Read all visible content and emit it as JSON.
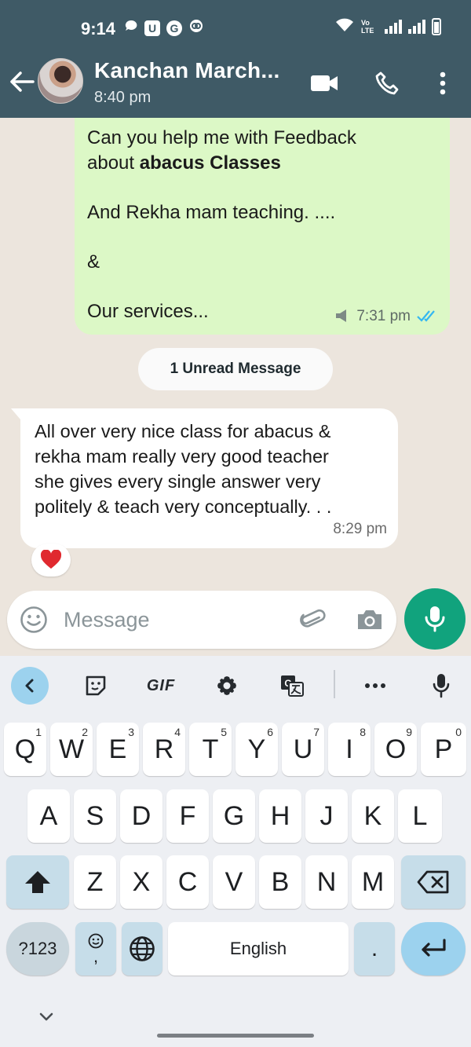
{
  "status_bar": {
    "time": "9:14",
    "left_icons": [
      "chat-bubble-icon",
      "u-badge-icon",
      "g-badge-icon",
      "cloud-icon"
    ],
    "network_label": "Vo LTE"
  },
  "header": {
    "contact_name": "Kanchan March...",
    "subtitle": "8:40 pm"
  },
  "messages": {
    "outgoing": {
      "line1": "Can you help me with  Feedback",
      "line2_prefix": "about ",
      "line2_bold": "abacus Classes",
      "line3": "",
      "line4": "And Rekha mam teaching. ....",
      "line5": "",
      "line6": "&",
      "line7": "",
      "line8": "Our services...",
      "time": "7:31 pm",
      "status": "read"
    },
    "unread_label": "1 Unread Message",
    "incoming": {
      "lines": [
        "All over very nice class for abacus &",
        "rekha mam really very good  teacher",
        "she gives every single answer very",
        "politely & teach very conceptually. .  ."
      ],
      "time": "8:29 pm",
      "reaction": "heart"
    }
  },
  "composer": {
    "placeholder": "Message"
  },
  "keyboard": {
    "toolbar": {
      "gif_label": "GIF"
    },
    "row1": [
      {
        "k": "Q",
        "n": "1"
      },
      {
        "k": "W",
        "n": "2"
      },
      {
        "k": "E",
        "n": "3"
      },
      {
        "k": "R",
        "n": "4"
      },
      {
        "k": "T",
        "n": "5"
      },
      {
        "k": "Y",
        "n": "6"
      },
      {
        "k": "U",
        "n": "7"
      },
      {
        "k": "I",
        "n": "8"
      },
      {
        "k": "O",
        "n": "9"
      },
      {
        "k": "P",
        "n": "0"
      }
    ],
    "row2": [
      "A",
      "S",
      "D",
      "F",
      "G",
      "H",
      "J",
      "K",
      "L"
    ],
    "row3": [
      "Z",
      "X",
      "C",
      "V",
      "B",
      "N",
      "M"
    ],
    "sym_label": "?123",
    "emoji_comma_label": ",",
    "space_label": "English",
    "period_label": "."
  },
  "colors": {
    "header": "#3f5a66",
    "outgoing_bubble": "#dcf8c6",
    "incoming_bubble": "#ffffff",
    "chat_bg": "#ece5dd",
    "accent_green": "#11a37d",
    "read_ticks": "#34b7f1",
    "keyboard_bg": "#edeff3",
    "keyboard_accent": "#9cd2ee"
  }
}
